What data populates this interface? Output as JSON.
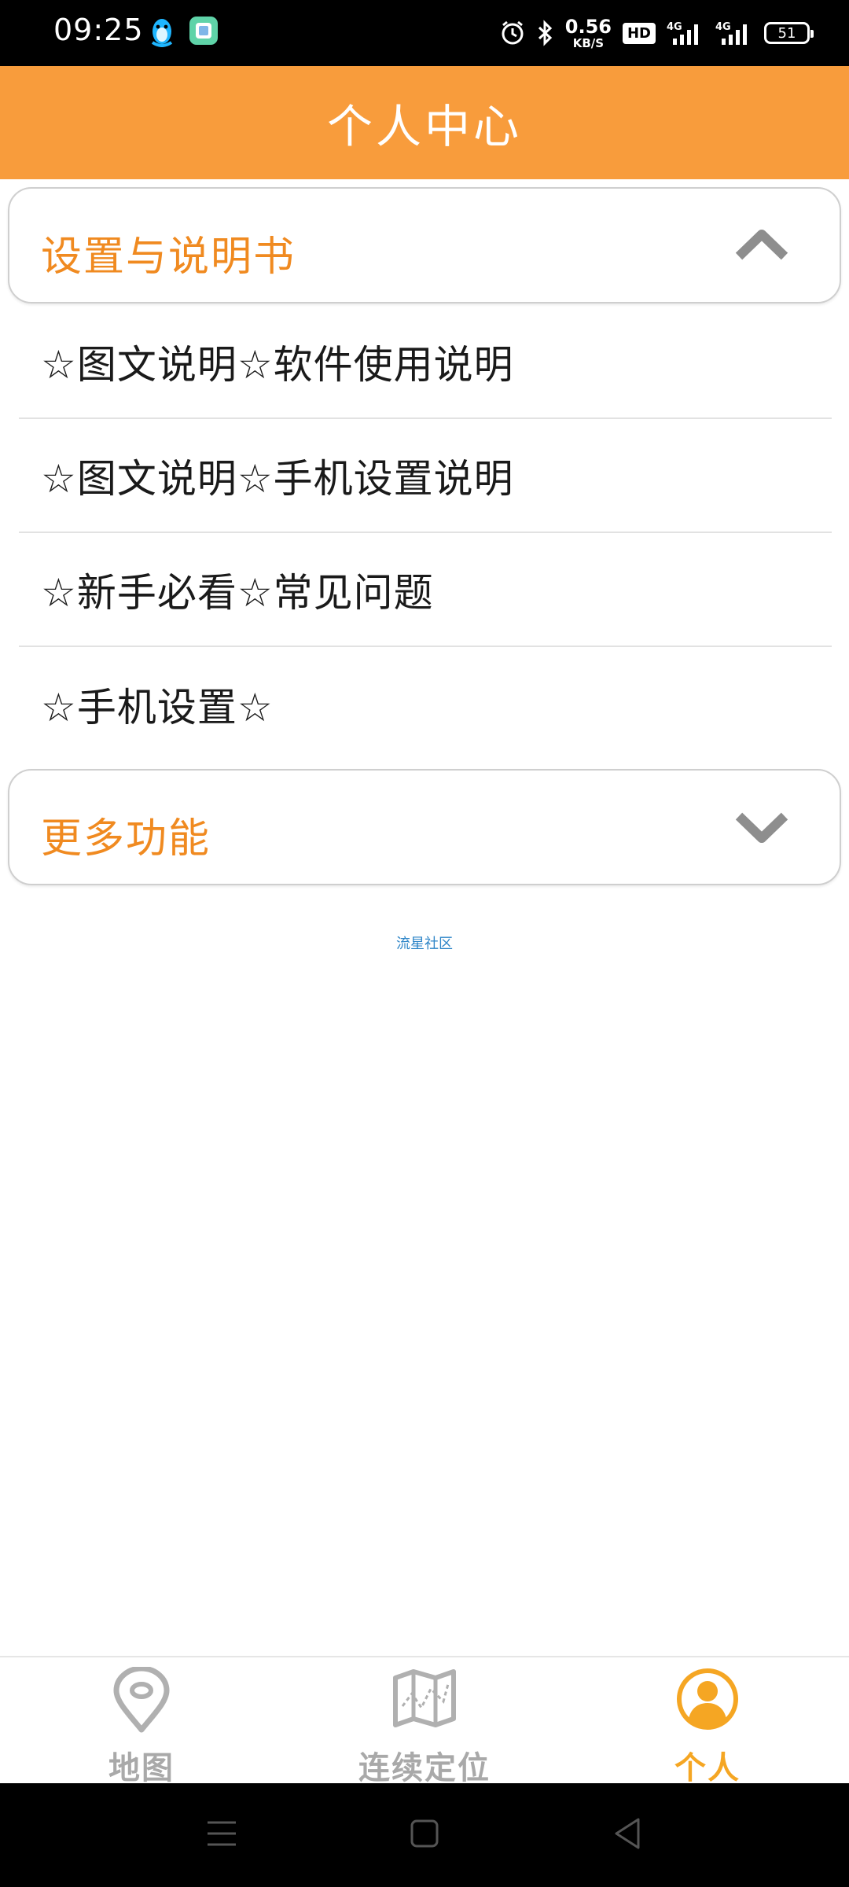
{
  "status_bar": {
    "time": "09:25",
    "net_speed_value": "0.56",
    "net_speed_unit": "KB/S",
    "hd_label": "HD",
    "signal_1_label": "4G",
    "signal_2_label": "4G",
    "battery": "51"
  },
  "header": {
    "title": "个人中心"
  },
  "section_settings": {
    "title": "设置与说明书",
    "expanded": true,
    "items": [
      "☆图文说明☆软件使用说明",
      "☆图文说明☆手机设置说明",
      "☆新手必看☆常见问题",
      "☆手机设置☆"
    ]
  },
  "section_more": {
    "title": "更多功能",
    "expanded": false
  },
  "footer": {
    "link_text": "流星社区"
  },
  "tabs": [
    {
      "label": "地图",
      "icon": "map-pin-icon",
      "active": false
    },
    {
      "label": "连续定位",
      "icon": "folded-map-icon",
      "active": false
    },
    {
      "label": "个人",
      "icon": "person-icon",
      "active": true
    }
  ],
  "colors": {
    "header_bg": "#f89c3c",
    "section_title": "#f08a20",
    "tab_active": "#f5a623",
    "tab_inactive": "#a9a9a9",
    "link": "#2f86c8"
  }
}
